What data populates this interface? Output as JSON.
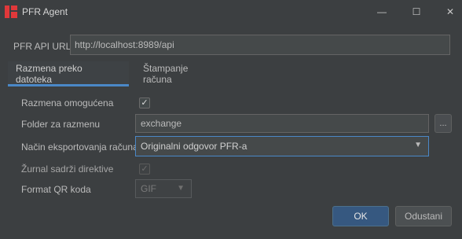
{
  "window": {
    "title": "PFR Agent",
    "app_icon": "pfr-logo-icon",
    "controls": {
      "minimize": "—",
      "maximize": "☐",
      "close": "✕"
    }
  },
  "api": {
    "label": "PFR API URL",
    "value": "http://localhost:8989/api"
  },
  "tabs": [
    {
      "label": "Razmena preko datoteka",
      "active": true
    },
    {
      "label": "Štampanje računa",
      "active": false
    }
  ],
  "form": {
    "exchange_enabled": {
      "label": "Razmena omogućena",
      "checked": true
    },
    "folder": {
      "label": "Folder za razmenu",
      "value": "exchange",
      "browse_label": "..."
    },
    "export_mode": {
      "label": "Način eksportovanja računa",
      "value": "Originalni odgovor PFR-a"
    },
    "journal_directives": {
      "label": "Žurnal sadrži direktive",
      "checked": true,
      "disabled": true
    },
    "qr_format": {
      "label": "Format QR koda",
      "value": "GIF",
      "disabled": true
    }
  },
  "buttons": {
    "ok": "OK",
    "cancel": "Odustani"
  },
  "colors": {
    "background": "#3c3f41",
    "accent": "#4a88c7",
    "primary_button": "#365880",
    "logo": "#e0383a"
  }
}
